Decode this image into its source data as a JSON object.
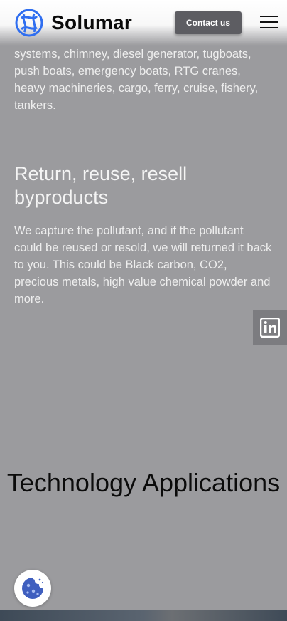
{
  "header": {
    "brand": "Solumar",
    "contact_label": "Contact us"
  },
  "content": {
    "paragraph1": "systems, chimney, diesel generator, tugboats, push boats, emergency boats, RTG cranes, heavy machineries, cargo, ferry, cruise, fishery, tankers.",
    "heading": "Return, reuse, resell byproducts",
    "paragraph2": "We capture the pollutant, and if the pollutant could be reused or resold, we will returned it back to you. This could be Black carbon, CO2, precious metals, high value chemical powder and more.",
    "section_title": "Technology Applications"
  },
  "icons": {
    "logo": "solumar-logo-icon",
    "menu": "hamburger-menu-icon",
    "linkedin": "linkedin-icon",
    "cookie": "cookie-icon"
  },
  "colors": {
    "overlay": "#9b9b9e",
    "brand_blue": "#2f6ef0",
    "contact_button": "#5d5d62",
    "linkedin_tab": "#7c7c80"
  }
}
